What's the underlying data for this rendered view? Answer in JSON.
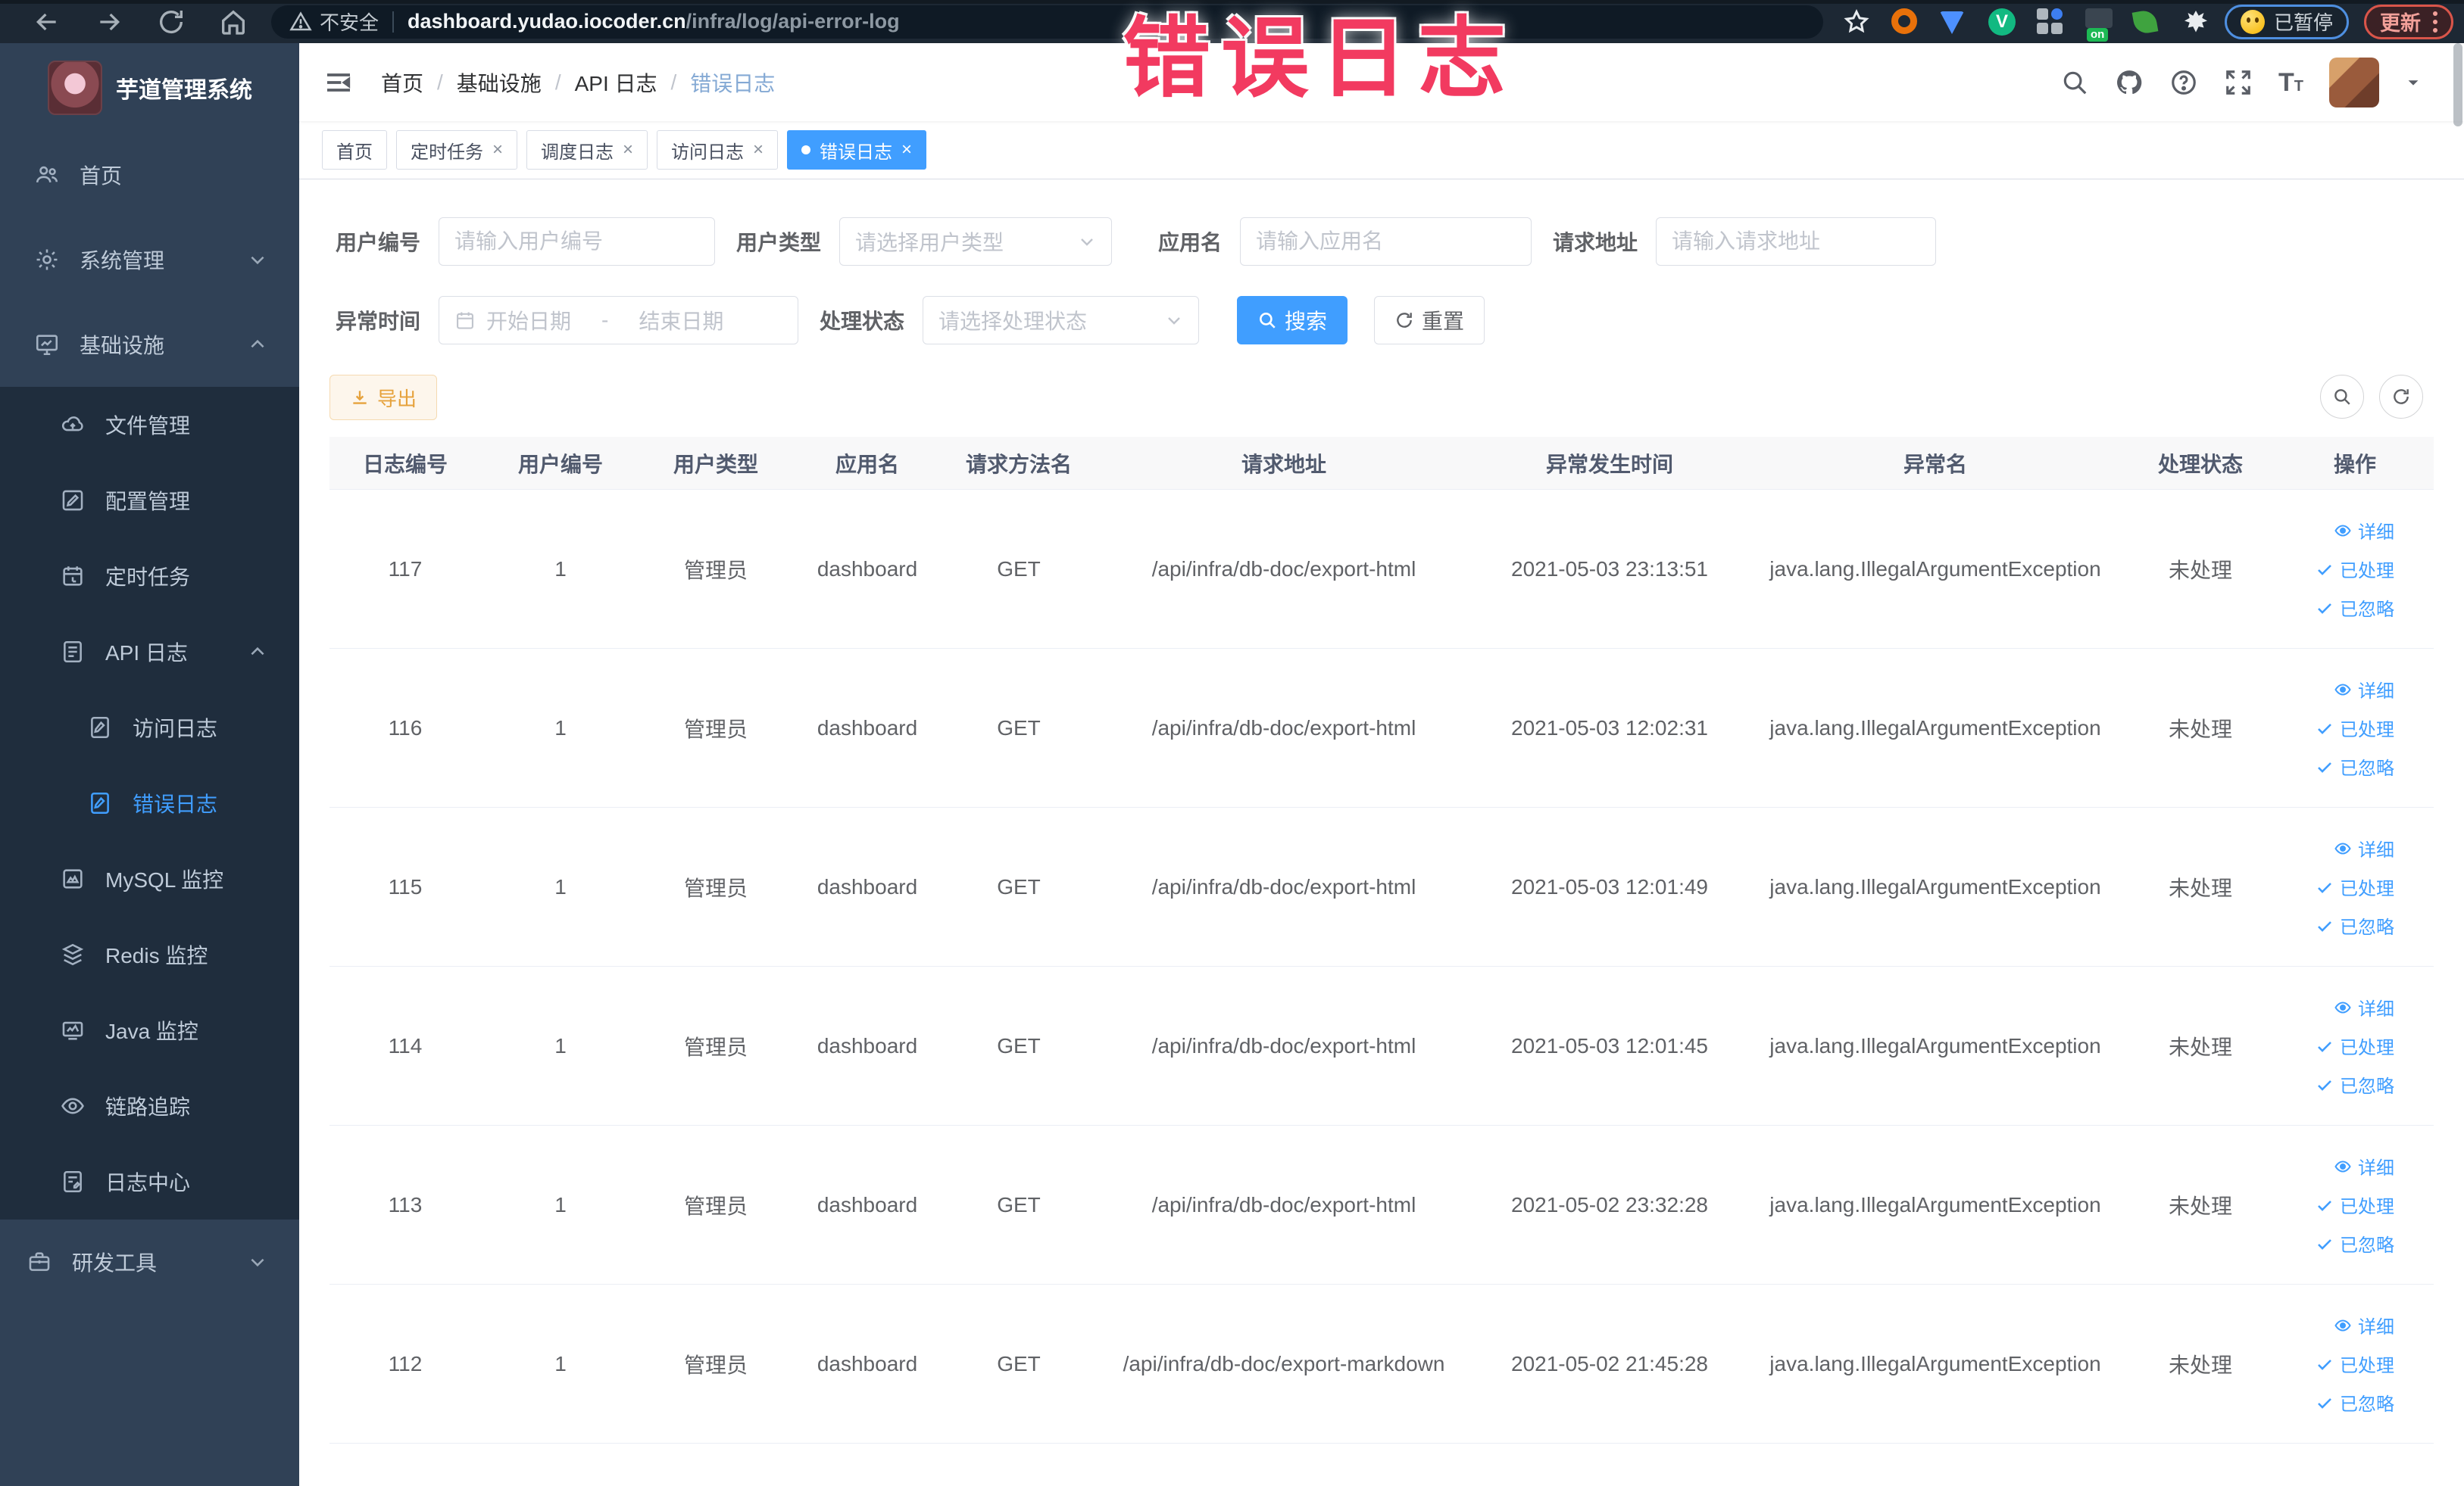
{
  "annotation": {
    "text": "错误日志"
  },
  "browser": {
    "security_label": "不安全",
    "url_domain": "dashboard.yudao.iocoder.cn",
    "url_path": "/infra/log/api-error-log",
    "paused_badge": "已暂停",
    "update_badge": "更新"
  },
  "sidebar": {
    "logo_title": "芋道管理系统",
    "items": [
      {
        "label": "首页"
      },
      {
        "label": "系统管理"
      },
      {
        "label": "基础设施"
      },
      {
        "label": "文件管理"
      },
      {
        "label": "配置管理"
      },
      {
        "label": "定时任务"
      },
      {
        "label": "API 日志"
      },
      {
        "label": "访问日志"
      },
      {
        "label": "错误日志"
      },
      {
        "label": "MySQL 监控"
      },
      {
        "label": "Redis 监控"
      },
      {
        "label": "Java 监控"
      },
      {
        "label": "链路追踪"
      },
      {
        "label": "日志中心"
      },
      {
        "label": "研发工具"
      }
    ]
  },
  "header": {
    "breadcrumb": [
      "首页",
      "基础设施",
      "API 日志",
      "错误日志"
    ]
  },
  "tabs": [
    {
      "label": "首页"
    },
    {
      "label": "定时任务"
    },
    {
      "label": "调度日志"
    },
    {
      "label": "访问日志"
    },
    {
      "label": "错误日志"
    }
  ],
  "filters": {
    "user_id": {
      "label": "用户编号",
      "placeholder": "请输入用户编号"
    },
    "user_type": {
      "label": "用户类型",
      "placeholder": "请选择用户类型"
    },
    "app_name": {
      "label": "应用名",
      "placeholder": "请输入应用名"
    },
    "request_url": {
      "label": "请求地址",
      "placeholder": "请输入请求地址"
    },
    "exception_time": {
      "label": "异常时间",
      "start_placeholder": "开始日期",
      "separator": "-",
      "end_placeholder": "结束日期"
    },
    "process_status": {
      "label": "处理状态",
      "placeholder": "请选择处理状态"
    },
    "search_label": "搜索",
    "reset_label": "重置"
  },
  "toolbar": {
    "export_label": "导出"
  },
  "table": {
    "columns": [
      "日志编号",
      "用户编号",
      "用户类型",
      "应用名",
      "请求方法名",
      "请求地址",
      "异常发生时间",
      "异常名",
      "处理状态",
      "操作"
    ],
    "row_actions": [
      "详细",
      "已处理",
      "已忽略"
    ],
    "rows": [
      {
        "log_id": "117",
        "user_id": "1",
        "user_type": "管理员",
        "app_name": "dashboard",
        "method": "GET",
        "url": "/api/infra/db-doc/export-html",
        "time": "2021-05-03 23:13:51",
        "exception": "java.lang.IllegalArgumentException",
        "status": "未处理"
      },
      {
        "log_id": "116",
        "user_id": "1",
        "user_type": "管理员",
        "app_name": "dashboard",
        "method": "GET",
        "url": "/api/infra/db-doc/export-html",
        "time": "2021-05-03 12:02:31",
        "exception": "java.lang.IllegalArgumentException",
        "status": "未处理"
      },
      {
        "log_id": "115",
        "user_id": "1",
        "user_type": "管理员",
        "app_name": "dashboard",
        "method": "GET",
        "url": "/api/infra/db-doc/export-html",
        "time": "2021-05-03 12:01:49",
        "exception": "java.lang.IllegalArgumentException",
        "status": "未处理"
      },
      {
        "log_id": "114",
        "user_id": "1",
        "user_type": "管理员",
        "app_name": "dashboard",
        "method": "GET",
        "url": "/api/infra/db-doc/export-html",
        "time": "2021-05-03 12:01:45",
        "exception": "java.lang.IllegalArgumentException",
        "status": "未处理"
      },
      {
        "log_id": "113",
        "user_id": "1",
        "user_type": "管理员",
        "app_name": "dashboard",
        "method": "GET",
        "url": "/api/infra/db-doc/export-html",
        "time": "2021-05-02 23:32:28",
        "exception": "java.lang.IllegalArgumentException",
        "status": "未处理"
      },
      {
        "log_id": "112",
        "user_id": "1",
        "user_type": "管理员",
        "app_name": "dashboard",
        "method": "GET",
        "url": "/api/infra/db-doc/export-markdown",
        "time": "2021-05-02 21:45:28",
        "exception": "java.lang.IllegalArgumentException",
        "status": "未处理"
      }
    ]
  }
}
